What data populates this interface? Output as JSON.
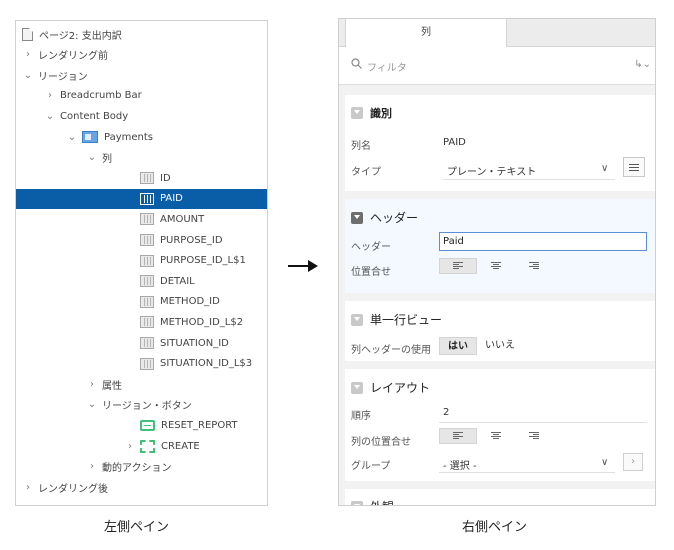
{
  "left_tree": [
    {
      "id": "page",
      "label": "ページ2: 支出内訳",
      "indent": 0,
      "chev": "",
      "icon": "page-icon"
    },
    {
      "id": "before-render",
      "label": "レンダリング前",
      "indent": 0,
      "chev": "›",
      "icon": ""
    },
    {
      "id": "regions",
      "label": "リージョン",
      "indent": 0,
      "chev": "⌄",
      "icon": ""
    },
    {
      "id": "breadcrumb-bar",
      "label": "Breadcrumb Bar",
      "indent": 1,
      "chev": "›",
      "icon": ""
    },
    {
      "id": "content-body",
      "label": "Content Body",
      "indent": 1,
      "chev": "⌄",
      "icon": ""
    },
    {
      "id": "payments",
      "label": "Payments",
      "indent": 2,
      "chev": "⌄",
      "icon": "region-icon"
    },
    {
      "id": "columns",
      "label": "列",
      "indent": 3,
      "chev": "⌄",
      "icon": ""
    },
    {
      "id": "col-id",
      "label": "ID",
      "indent": 4,
      "chev": "",
      "icon": "column-icon"
    },
    {
      "id": "col-paid",
      "label": "PAID",
      "indent": 4,
      "chev": "",
      "icon": "column-icon",
      "selected": true
    },
    {
      "id": "col-amount",
      "label": "AMOUNT",
      "indent": 4,
      "chev": "",
      "icon": "column-icon"
    },
    {
      "id": "col-purpose-id",
      "label": "PURPOSE_ID",
      "indent": 4,
      "chev": "",
      "icon": "column-icon"
    },
    {
      "id": "col-purpose-id-l1",
      "label": "PURPOSE_ID_L$1",
      "indent": 4,
      "chev": "",
      "icon": "column-icon"
    },
    {
      "id": "col-detail",
      "label": "DETAIL",
      "indent": 4,
      "chev": "",
      "icon": "column-icon"
    },
    {
      "id": "col-method-id",
      "label": "METHOD_ID",
      "indent": 4,
      "chev": "",
      "icon": "column-icon"
    },
    {
      "id": "col-method-id-l2",
      "label": "METHOD_ID_L$2",
      "indent": 4,
      "chev": "",
      "icon": "column-icon"
    },
    {
      "id": "col-situation-id",
      "label": "SITUATION_ID",
      "indent": 4,
      "chev": "",
      "icon": "column-icon"
    },
    {
      "id": "col-situation-id-l3",
      "label": "SITUATION_ID_L$3",
      "indent": 4,
      "chev": "",
      "icon": "column-icon"
    },
    {
      "id": "attributes",
      "label": "属性",
      "indent": 3,
      "chev": "›",
      "icon": ""
    },
    {
      "id": "region-buttons",
      "label": "リージョン・ボタン",
      "indent": 3,
      "chev": "⌄",
      "icon": ""
    },
    {
      "id": "btn-reset-report",
      "label": "RESET_REPORT",
      "indent": 4,
      "chev": "",
      "icon": "button-icon"
    },
    {
      "id": "btn-create",
      "label": "CREATE",
      "indent": 4,
      "chev": "›",
      "icon": "create-button-icon"
    },
    {
      "id": "dynamic-actions",
      "label": "動的アクション",
      "indent": 3,
      "chev": "›",
      "icon": ""
    },
    {
      "id": "after-render",
      "label": "レンダリング後",
      "indent": 0,
      "chev": "›",
      "icon": ""
    }
  ],
  "right": {
    "tab_label": "列",
    "filter_placeholder": "フィルタ",
    "goto_icon": "↳⌄",
    "identification": {
      "title": "識別",
      "column_name_label": "列名",
      "column_name_value": "PAID",
      "type_label": "タイプ",
      "type_value": "プレーン・テキスト",
      "type_chevron": "∨"
    },
    "header": {
      "title": "ヘッダー",
      "header_label": "ヘッダー",
      "header_value": "Paid",
      "alignment_label": "位置合せ"
    },
    "single_row_view": {
      "title": "単一行ビュー",
      "use_header_label": "列ヘッダーの使用",
      "yes": "はい",
      "no": "いいえ"
    },
    "layout": {
      "title": "レイアウト",
      "sequence_label": "順序",
      "sequence_value": "2",
      "column_alignment_label": "列の位置合せ",
      "group_label": "グループ",
      "group_value": "- 選択 -",
      "group_chevron": "∨",
      "next_btn": "›"
    },
    "appearance": {
      "title": "外観"
    }
  },
  "captions": {
    "left": "左側ペイン",
    "right": "右側ペイン"
  },
  "colors": {
    "selected_bg": "#0a5ea8",
    "region_icon": "#6aa5e3",
    "button_icon": "#3fbf7a"
  }
}
